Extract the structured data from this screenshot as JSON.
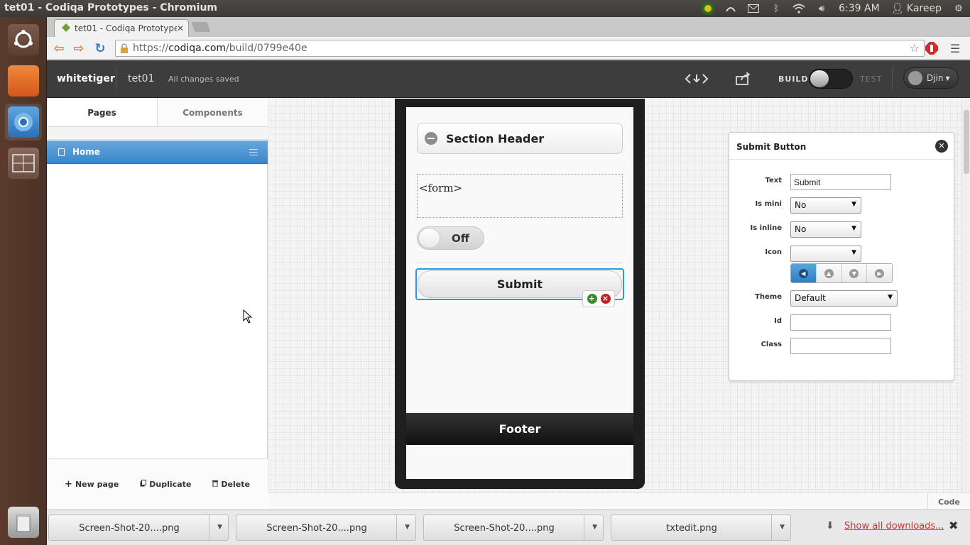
{
  "os_panel": {
    "window_title": "tet01 - Codiqa Prototypes - Chromium",
    "clock": "6:39 AM",
    "user": "Kareep"
  },
  "browser": {
    "tab_title": "tet01 - Codiqa Prototypes",
    "url_scheme": "https://",
    "url_host": "codiqa.com",
    "url_path": "/build/0799e40e"
  },
  "app_header": {
    "project": "whitetiger",
    "page": "tet01",
    "save_status": "All changes saved",
    "build_label": "BUILD",
    "test_label": "TEST",
    "user_menu": "Djin"
  },
  "left_panel": {
    "tabs": [
      {
        "label": "Pages"
      },
      {
        "label": "Components"
      }
    ],
    "pages": [
      {
        "label": "Home"
      }
    ],
    "actions": {
      "new_page": "New page",
      "duplicate": "Duplicate",
      "delete": "Delete"
    }
  },
  "phone_preview": {
    "section_header": "Section Header",
    "form_placeholder": "<form>",
    "flip_switch_label": "Off",
    "submit_label": "Submit",
    "footer_label": "Footer"
  },
  "properties": {
    "title": "Submit Button",
    "fields": {
      "text_label": "Text",
      "text_value": "Submit",
      "is_mini_label": "Is mini",
      "is_mini_value": "No",
      "is_inline_label": "Is inline",
      "is_inline_value": "No",
      "icon_label": "Icon",
      "icon_value": "",
      "theme_label": "Theme",
      "theme_value": "Default",
      "id_label": "Id",
      "id_value": "",
      "class_label": "Class",
      "class_value": ""
    },
    "icon_positions": [
      "left",
      "top",
      "bottom",
      "right"
    ],
    "icon_position_selected": "left"
  },
  "canvas_footer": {
    "code_label": "Code"
  },
  "downloads": {
    "items": [
      {
        "name": "Screen-Shot-20....png"
      },
      {
        "name": "Screen-Shot-20....png"
      },
      {
        "name": "Screen-Shot-20....png"
      },
      {
        "name": "txtedit.png"
      }
    ],
    "show_all": "Show all downloads..."
  },
  "colors": {
    "accent_blue": "#3a86c8",
    "selection_border": "#2a9bd8",
    "download_link": "#cc3333"
  }
}
